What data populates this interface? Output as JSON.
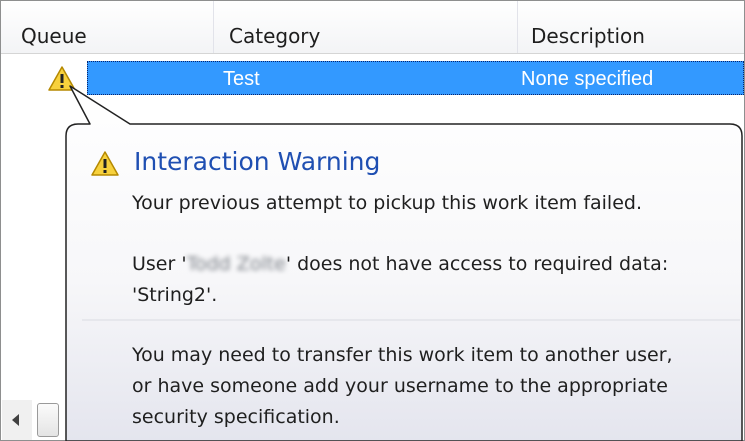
{
  "columns": {
    "queue": "Queue",
    "category": "Category",
    "description": "Description"
  },
  "row": {
    "status_icon": "warning-icon",
    "category": "Test",
    "description": "None specified"
  },
  "tooltip": {
    "icon": "warning-icon",
    "title": "Interaction Warning",
    "line1": "Your previous attempt to pickup this work item failed.",
    "user_prefix": "User '",
    "user_name": "Todd Zolte",
    "user_suffix": "' does not have access to required data:",
    "data_name": "'String2'.",
    "advice_line1": "You may need to transfer this work item to another user,",
    "advice_line2": "or have someone add your username to the appropriate",
    "advice_line3": "security specification."
  },
  "colors": {
    "selection": "#3399ff",
    "tooltip_title": "#1f4fb2",
    "warning_fill": "#f7d13d"
  }
}
